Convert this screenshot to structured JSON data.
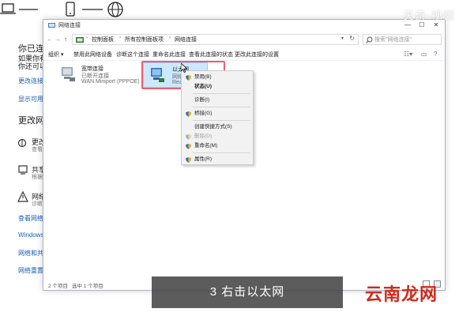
{
  "background_page": {
    "lines": [
      "你已连接",
      "如果你有",
      "你还可以",
      "更改连接",
      "显示可用",
      "更改网",
      "更改",
      "查看",
      "共享",
      "根据",
      "网络",
      "诊断",
      "查看网络",
      "Windows",
      "网络和共",
      "网络重置"
    ]
  },
  "window": {
    "title": "网络连接",
    "minimize": "—",
    "maximize": "☐",
    "close": "✕",
    "breadcrumbs": [
      "控制面板",
      "所有控制面板项",
      "网络连接"
    ],
    "search_placeholder": "搜索\"网络连接\"",
    "commands": [
      "组织",
      "禁用此网络设备",
      "诊断这个连接",
      "重命名此连接",
      "查看此连接的状态",
      "更改此连接的设置"
    ],
    "organize_arrow": "▾",
    "items": [
      {
        "name": "宽带连接",
        "status": "已断开连接",
        "device": "WAN Miniport (PPPOE)"
      },
      {
        "name": "以太网",
        "status": "网络",
        "device": "Realtek"
      }
    ],
    "context_menu": [
      {
        "label": "禁用(B)",
        "style": "normal"
      },
      {
        "label": "状态(U)",
        "style": "bold"
      },
      {
        "label": "诊断(I)",
        "style": "normal"
      },
      {
        "label": "桥接(G)",
        "style": "normal"
      },
      {
        "label": "创建快捷方式(S)",
        "style": "normal"
      },
      {
        "label": "删除(D)",
        "style": "disabled"
      },
      {
        "label": "重命名(M)",
        "style": "normal"
      },
      {
        "label": "属性(R)",
        "style": "normal"
      }
    ],
    "status_count": "2 个项目",
    "status_selected": "选中 1 个项目"
  },
  "overlay": {
    "watermark_top": "天奇·视频",
    "caption": "3 右击以太网",
    "watermark_bottom": "云南龙网"
  },
  "colors": {
    "selection": "#cce8ff",
    "highlight_border": "#e8606e",
    "watermark_red": "#cf2b1c"
  }
}
